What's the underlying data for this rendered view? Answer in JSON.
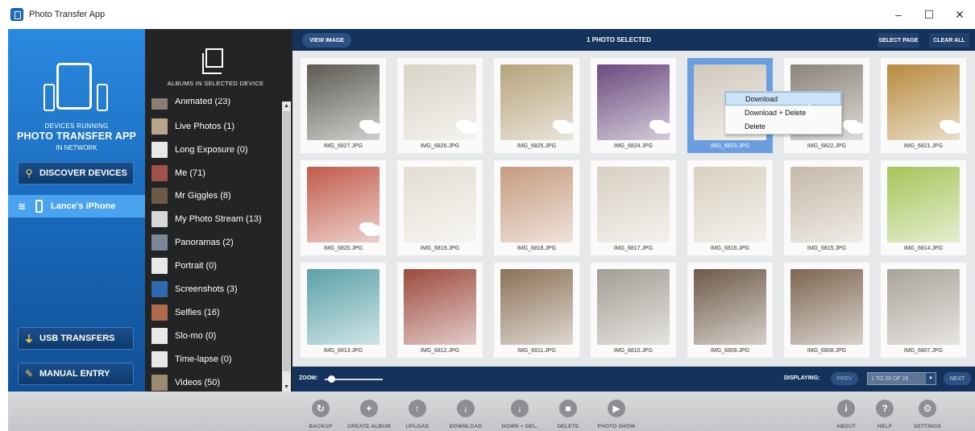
{
  "window": {
    "title": "Photo Transfer App",
    "minimize_glyph": "–",
    "maximize_glyph": "☐",
    "close_glyph": "✕"
  },
  "sidebar": {
    "caption_line1": "DEVICES RUNNING",
    "caption_line2": "PHOTO TRANSFER APP",
    "caption_line3": "IN NETWORK",
    "discover_label": "DISCOVER DEVICES",
    "device_name": "Lance's iPhone",
    "usb_label": "USB TRANSFERS",
    "manual_label": "MANUAL ENTRY"
  },
  "albums": {
    "title": "ALBUMS IN SELECTED DEVICE",
    "items": [
      {
        "label": "Animated (23)",
        "color": "#8a7f70"
      },
      {
        "label": "Live Photos (1)",
        "color": "#b9a58c"
      },
      {
        "label": "Long Exposure (0)",
        "color": "#e8e8e8"
      },
      {
        "label": "Me (71)",
        "color": "#a0524a"
      },
      {
        "label": "Mr Giggles (8)",
        "color": "#6b5a45"
      },
      {
        "label": "My Photo Stream (13)",
        "color": "#d8d8d8"
      },
      {
        "label": "Panoramas (2)",
        "color": "#7a8796"
      },
      {
        "label": "Portrait (0)",
        "color": "#e8e8e8"
      },
      {
        "label": "Screenshots (3)",
        "color": "#2f6ab0"
      },
      {
        "label": "Selfies (16)",
        "color": "#b06a4e"
      },
      {
        "label": "Slo-mo (0)",
        "color": "#e8e8e8"
      },
      {
        "label": "Time-lapse (0)",
        "color": "#e8e8e8"
      },
      {
        "label": "Videos (50)",
        "color": "#9c8a70"
      }
    ]
  },
  "main": {
    "view_image_label": "VIEW IMAGE",
    "selected_count": "1 PHOTO SELECTED",
    "select_page_label": "SELECT PAGE",
    "clear_all_label": "CLEAR ALL",
    "zoom_label": "ZOOM:",
    "displaying_label": "DISPLAYING:",
    "prev_label": "PREV",
    "range_value": "1 TO 28 OF 28",
    "next_label": "NEXT"
  },
  "photos": [
    {
      "name": "IMG_6827.JPG",
      "color": "#5c5a52",
      "cloud": true,
      "selected": false
    },
    {
      "name": "IMG_6826.JPG",
      "color": "#d9d3c8",
      "cloud": true,
      "selected": false
    },
    {
      "name": "IMG_6825.JPG",
      "color": "#b6a37a",
      "cloud": true,
      "selected": false
    },
    {
      "name": "IMG_6824.JPG",
      "color": "#6b4a7e",
      "cloud": true,
      "selected": false
    },
    {
      "name": "IMG_6823.JPG",
      "color": "#cfc7ba",
      "cloud": true,
      "selected": true
    },
    {
      "name": "IMG_6822.JPG",
      "color": "#8a8378",
      "cloud": true,
      "selected": false
    },
    {
      "name": "IMG_6821.JPG",
      "color": "#b78a3e",
      "cloud": true,
      "selected": false
    },
    {
      "name": "IMG_6820.JPG",
      "color": "#c15b4a",
      "cloud": true,
      "selected": false
    },
    {
      "name": "IMG_6819.JPG",
      "color": "#e3ddd3",
      "cloud": false,
      "selected": false
    },
    {
      "name": "IMG_6818.JPG",
      "color": "#c69b7f",
      "cloud": false,
      "selected": false
    },
    {
      "name": "IMG_6817.JPG",
      "color": "#d7cfc2",
      "cloud": false,
      "selected": false
    },
    {
      "name": "IMG_6816.JPG",
      "color": "#d8d0c0",
      "cloud": false,
      "selected": false
    },
    {
      "name": "IMG_6815.JPG",
      "color": "#c5b9a8",
      "cloud": false,
      "selected": false
    },
    {
      "name": "IMG_6814.JPG",
      "color": "#a6c45a",
      "cloud": false,
      "selected": false
    },
    {
      "name": "IMG_6813.JPG",
      "color": "#5aa1a8",
      "cloud": false,
      "selected": false
    },
    {
      "name": "IMG_6812.JPG",
      "color": "#9c4a3e",
      "cloud": false,
      "selected": false
    },
    {
      "name": "IMG_6811.JPG",
      "color": "#8c7258",
      "cloud": false,
      "selected": false
    },
    {
      "name": "IMG_6810.JPG",
      "color": "#a39d94",
      "cloud": false,
      "selected": false
    },
    {
      "name": "IMG_6809.JPG",
      "color": "#6e5a48",
      "cloud": false,
      "selected": false
    },
    {
      "name": "IMG_6808.JPG",
      "color": "#7d6550",
      "cloud": false,
      "selected": false
    },
    {
      "name": "IMG_6807.JPG",
      "color": "#a9a39a",
      "cloud": false,
      "selected": false
    }
  ],
  "context_menu": {
    "items": [
      "Download",
      "Download + Delete",
      "Delete"
    ]
  },
  "toolbar": {
    "items": [
      {
        "label": "BACKUP",
        "icon": "backup-icon",
        "glyph": "↻"
      },
      {
        "label": "CREATE ALBUM",
        "icon": "plus-icon",
        "glyph": "+"
      },
      {
        "label": "UPLOAD",
        "icon": "upload-icon",
        "glyph": "↑"
      },
      {
        "label": "DOWNLOAD",
        "icon": "download-icon",
        "glyph": "↓"
      },
      {
        "label": "DOWN + DEL.",
        "icon": "download-delete-icon",
        "glyph": "↓"
      },
      {
        "label": "DELETE",
        "icon": "trash-icon",
        "glyph": "■"
      },
      {
        "label": "PHOTO SHOW",
        "icon": "play-icon",
        "glyph": "▶"
      },
      {
        "label": "ABOUT",
        "icon": "info-icon",
        "glyph": "i"
      },
      {
        "label": "HELP",
        "icon": "help-icon",
        "glyph": "?"
      },
      {
        "label": "SETTINGS",
        "icon": "settings-icon",
        "glyph": "⚙"
      }
    ]
  }
}
